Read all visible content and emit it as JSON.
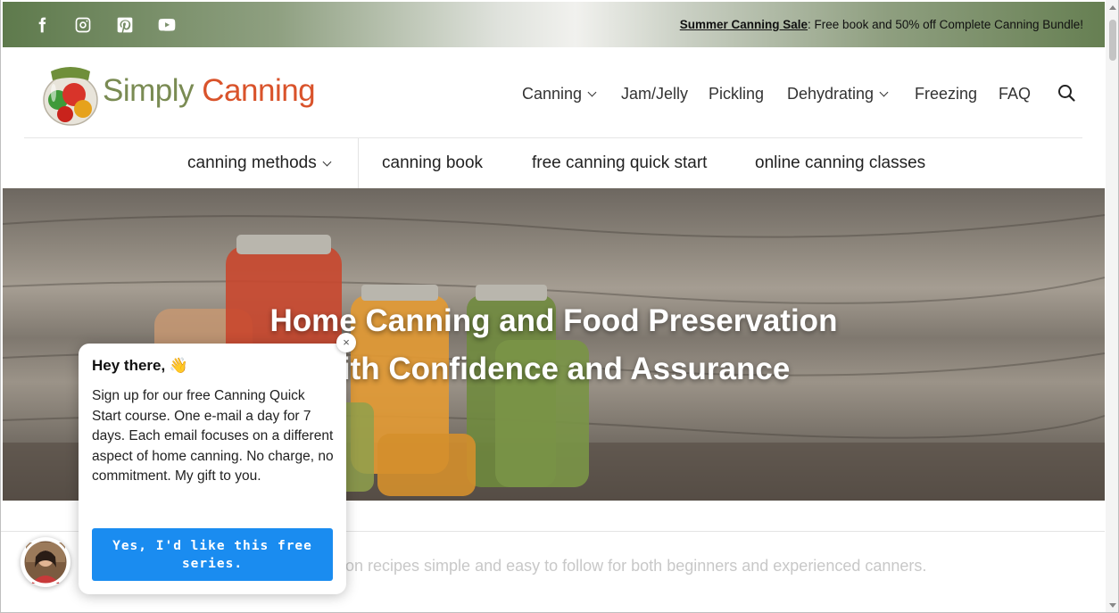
{
  "topbar": {
    "social": [
      "facebook-icon",
      "instagram-icon",
      "pinterest-icon",
      "youtube-icon"
    ],
    "promo_link": "Summer Canning Sale",
    "promo_text": ": Free book and 50% off Complete Canning Bundle!"
  },
  "logo": {
    "simply": "Simply",
    "canning": "Canning"
  },
  "main_nav": [
    {
      "label": "Canning",
      "dropdown": true
    },
    {
      "label": "Jam/Jelly",
      "dropdown": false
    },
    {
      "label": "Pickling",
      "dropdown": false
    },
    {
      "label": "Dehydrating",
      "dropdown": true
    },
    {
      "label": "Freezing",
      "dropdown": false
    },
    {
      "label": "FAQ",
      "dropdown": false
    }
  ],
  "sub_nav": [
    {
      "label": "canning methods",
      "dropdown": true
    },
    {
      "label": "canning book"
    },
    {
      "label": "free canning quick start"
    },
    {
      "label": "online canning classes"
    }
  ],
  "hero": {
    "line1": "Home Canning and Food Preservation",
    "line2": "with Confidence and Assurance"
  },
  "tagline": "on recipes simple and easy to follow for both beginners and experienced canners.",
  "popup": {
    "title": "Hey there, 👋",
    "body": "Sign up for our free Canning Quick Start course.  One e-mail a day for 7 days. Each email focuses on a different aspect of home canning. No charge, no commitment.  My gift to you.",
    "button": "Yes, I'd like this free series.",
    "close": "×"
  },
  "colors": {
    "accent_orange": "#d9532b",
    "accent_green": "#7a8b53",
    "button_blue": "#1a8cf0"
  }
}
